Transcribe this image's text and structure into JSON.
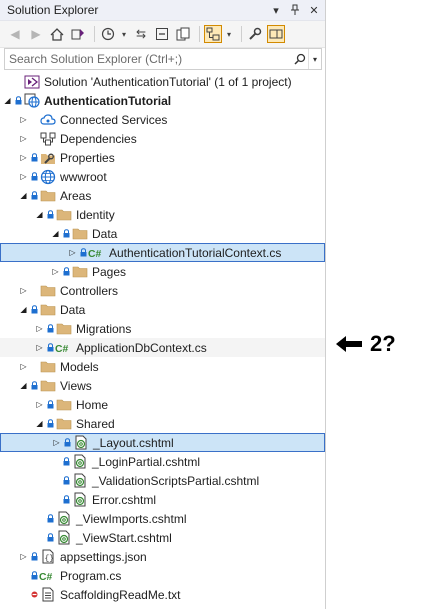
{
  "window": {
    "title": "Solution Explorer"
  },
  "search": {
    "placeholder": "Search Solution Explorer (Ctrl+;)"
  },
  "annotation": {
    "text": "2?"
  },
  "colors": {
    "selection_bg": "#cce4f7",
    "selection_border": "#3a70c8",
    "csharp_green": "#388a34",
    "folder_yellow": "#dcb67a",
    "vs_purple": "#68217a",
    "lock_blue": "#1e6fd0"
  },
  "tree": [
    {
      "label": "Solution 'AuthenticationTutorial' (1 of 1 project)",
      "icon": "solution-icon",
      "expander": "",
      "lock": false,
      "level": 0
    },
    {
      "label": "AuthenticationTutorial",
      "icon": "web-project-icon",
      "expander": "expanded",
      "lock": true,
      "level": 0,
      "bold": true
    },
    {
      "label": "Connected Services",
      "icon": "connected-services-icon",
      "expander": "collapsed",
      "lock": false,
      "level": 1
    },
    {
      "label": "Dependencies",
      "icon": "dependencies-icon",
      "expander": "collapsed",
      "lock": false,
      "level": 1
    },
    {
      "label": "Properties",
      "icon": "properties-icon",
      "expander": "collapsed",
      "lock": true,
      "level": 1
    },
    {
      "label": "wwwroot",
      "icon": "globe-icon",
      "expander": "collapsed",
      "lock": true,
      "level": 1
    },
    {
      "label": "Areas",
      "icon": "folder-icon",
      "expander": "expanded",
      "lock": true,
      "level": 1
    },
    {
      "label": "Identity",
      "icon": "folder-icon",
      "expander": "expanded",
      "lock": true,
      "level": 2
    },
    {
      "label": "Data",
      "icon": "folder-icon",
      "expander": "expanded",
      "lock": true,
      "level": 3
    },
    {
      "label": "AuthenticationTutorialContext.cs",
      "icon": "csharp-file-icon",
      "expander": "collapsed",
      "lock": true,
      "level": 4,
      "selected": true
    },
    {
      "label": "Pages",
      "icon": "folder-icon",
      "expander": "collapsed",
      "lock": true,
      "level": 3
    },
    {
      "label": "Controllers",
      "icon": "folder-icon",
      "expander": "collapsed",
      "lock": false,
      "level": 1
    },
    {
      "label": "Data",
      "icon": "folder-icon",
      "expander": "expanded",
      "lock": true,
      "level": 1
    },
    {
      "label": "Migrations",
      "icon": "folder-icon",
      "expander": "collapsed",
      "lock": true,
      "level": 2
    },
    {
      "label": "ApplicationDbContext.cs",
      "icon": "csharp-file-icon",
      "expander": "collapsed",
      "lock": true,
      "level": 2,
      "hover": true
    },
    {
      "label": "Models",
      "icon": "folder-icon",
      "expander": "collapsed",
      "lock": false,
      "level": 1
    },
    {
      "label": "Views",
      "icon": "folder-icon",
      "expander": "expanded",
      "lock": true,
      "level": 1
    },
    {
      "label": "Home",
      "icon": "folder-icon",
      "expander": "collapsed",
      "lock": true,
      "level": 2
    },
    {
      "label": "Shared",
      "icon": "folder-icon",
      "expander": "expanded",
      "lock": true,
      "level": 2
    },
    {
      "label": "_Layout.cshtml",
      "icon": "razor-file-icon",
      "expander": "collapsed",
      "lock": true,
      "level": 3,
      "selected": true
    },
    {
      "label": "_LoginPartial.cshtml",
      "icon": "razor-file-icon",
      "expander": "",
      "lock": true,
      "level": 3
    },
    {
      "label": "_ValidationScriptsPartial.cshtml",
      "icon": "razor-file-icon",
      "expander": "",
      "lock": true,
      "level": 3
    },
    {
      "label": "Error.cshtml",
      "icon": "razor-file-icon",
      "expander": "",
      "lock": true,
      "level": 3
    },
    {
      "label": "_ViewImports.cshtml",
      "icon": "razor-file-icon",
      "expander": "",
      "lock": true,
      "level": 2
    },
    {
      "label": "_ViewStart.cshtml",
      "icon": "razor-file-icon",
      "expander": "",
      "lock": true,
      "level": 2
    },
    {
      "label": "appsettings.json",
      "icon": "json-file-icon",
      "expander": "collapsed",
      "lock": true,
      "level": 1
    },
    {
      "label": "Program.cs",
      "icon": "csharp-file-icon",
      "expander": "",
      "lock": true,
      "level": 1
    },
    {
      "label": "ScaffoldingReadMe.txt",
      "icon": "text-file-icon",
      "expander": "",
      "lock": false,
      "level": 1,
      "redmark": true
    }
  ]
}
